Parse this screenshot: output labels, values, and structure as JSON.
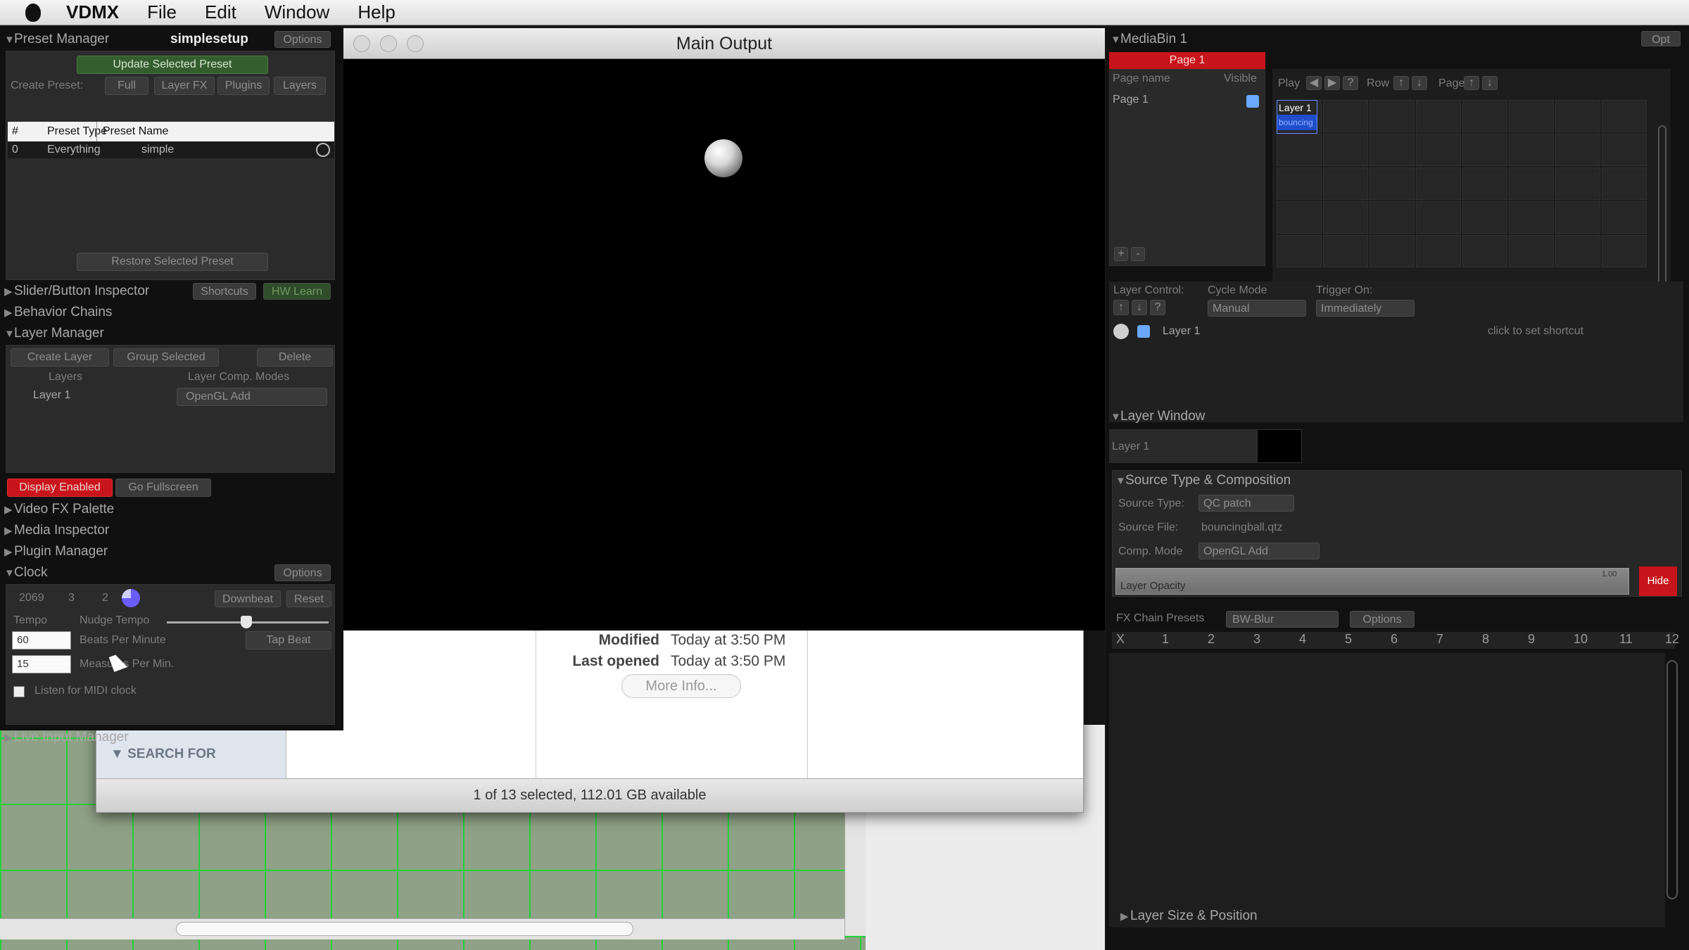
{
  "menubar": {
    "app": "VDMX",
    "items": [
      "File",
      "Edit",
      "Window",
      "Help"
    ]
  },
  "preset_manager": {
    "title": "Preset Manager",
    "name": "simplesetup",
    "options": "Options",
    "update_button": "Update Selected Preset",
    "create_preset_label": "Create Preset:",
    "create_buttons": [
      "Full",
      "Layer FX",
      "Plugins",
      "Layers"
    ],
    "table_headers": [
      "#",
      "Preset Type",
      "Preset Name"
    ],
    "rows": [
      {
        "num": "0",
        "type": "Everything",
        "name": "simple"
      }
    ],
    "restore_button": "Restore Selected Preset"
  },
  "slider_inspector": {
    "title": "Slider/Button Inspector",
    "shortcuts": "Shortcuts",
    "hw_learn": "HW Learn"
  },
  "behavior_chains": {
    "title": "Behavior Chains"
  },
  "layer_manager": {
    "title": "Layer Manager",
    "buttons": [
      "Create Layer",
      "Group Selected",
      "Delete"
    ],
    "col_layers": "Layers",
    "col_comp": "Layer Comp. Modes",
    "layer_name": "Layer 1",
    "comp_mode": "OpenGL Add",
    "display_enabled": "Display Enabled",
    "go_fullscreen": "Go Fullscreen"
  },
  "collapsed_sections": [
    "Video FX Palette",
    "Media Inspector",
    "Plugin Manager"
  ],
  "clock": {
    "title": "Clock",
    "options": "Options",
    "counter": [
      "2069",
      "3",
      "2"
    ],
    "downbeat": "Downbeat",
    "reset": "Reset",
    "tempo_label": "Tempo",
    "nudge_label": "Nudge Tempo",
    "bpm_value": "60",
    "bpm_label": "Beats Per Minute",
    "tap_beat": "Tap Beat",
    "mpm_value": "15",
    "mpm_label": "Measures Per Min.",
    "midi_clock": "Listen for MIDI clock",
    "nudge_level": 0.49
  },
  "live_input": {
    "title": "Live Input Manager"
  },
  "main_output": {
    "title": "Main Output"
  },
  "finder": {
    "search_for": "SEARCH FOR",
    "modified_label": "Modified",
    "modified_value": "Today at 3:50 PM",
    "opened_label": "Last opened",
    "opened_value": "Today at 3:50 PM",
    "more_info": "More Info...",
    "status": "1 of 13 selected, 112.01 GB available"
  },
  "mediabin": {
    "title": "MediaBin 1",
    "opt": "Opt",
    "page_tab": "Page 1",
    "page_name_header": "Page name",
    "visible_header": "Visible",
    "page_row": "Page 1",
    "play_label": "Play",
    "row_label": "Row",
    "page_label": "Page",
    "cell_title": "Layer 1",
    "cell_sub": "bouncing",
    "layer_control": "Layer Control:",
    "cycle_mode_label": "Cycle Mode",
    "cycle_mode": "Manual",
    "trigger_label": "Trigger On:",
    "trigger": "Immediately",
    "layer_row": "Layer 1",
    "shortcut": "click to set shortcut"
  },
  "layer_window": {
    "title": "Layer Window",
    "layer": "Layer 1",
    "source_section": "Source Type & Composition",
    "source_type_label": "Source Type:",
    "source_type": "QC patch",
    "source_file_label": "Source File:",
    "source_file": "bouncingball.qtz",
    "comp_mode_label": "Comp. Mode",
    "comp_mode": "OpenGL Add",
    "opacity_label": "Layer Opacity",
    "opacity_value": "1.00",
    "hide": "Hide",
    "fx_presets_label": "FX Chain Presets",
    "fx_preset": "BW-Blur",
    "fx_options": "Options",
    "fx_numbers": [
      "X",
      "1",
      "2",
      "3",
      "4",
      "5",
      "6",
      "7",
      "8",
      "9",
      "10",
      "11",
      "12"
    ],
    "size_position": "Layer Size & Position"
  },
  "colors": {
    "accent_red": "#c8141c",
    "accent_blue": "#2a5bd7",
    "green_button": "#3d6b35"
  }
}
